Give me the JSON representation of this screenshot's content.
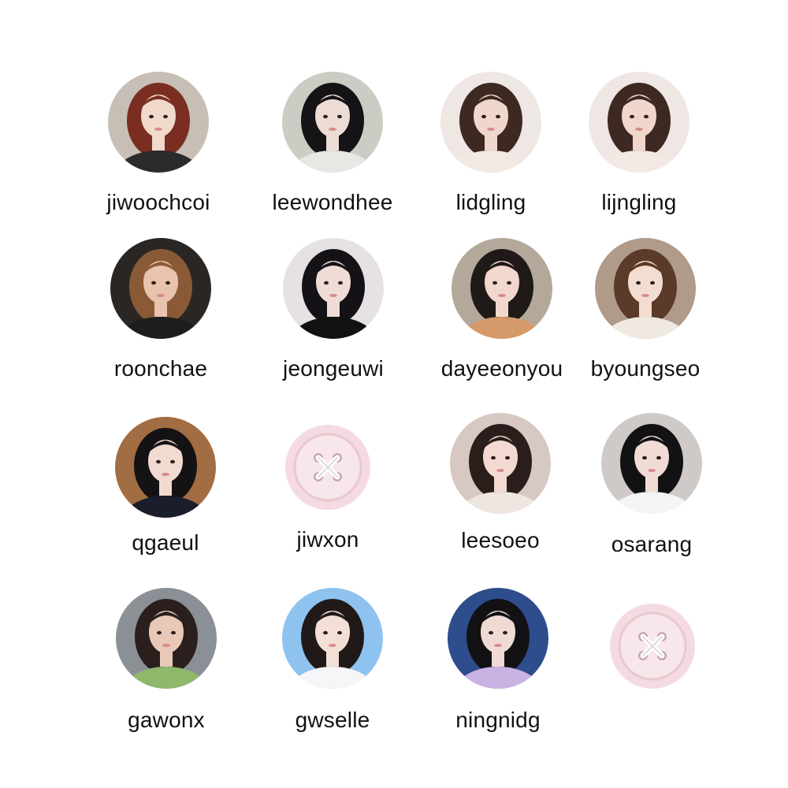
{
  "profiles": [
    {
      "username": "jiwoochcoi",
      "avatar": "photo",
      "bg": "#c7bfb6",
      "hair": "#7a2e22",
      "skin": "#f1d9cc",
      "top": "#2b2b2b"
    },
    {
      "username": "leewondhee",
      "avatar": "photo",
      "bg": "#c9cdc3",
      "hair": "#151316",
      "skin": "#ecdcd4",
      "top": "#e7e7e4"
    },
    {
      "username": "lidgling",
      "avatar": "photo",
      "bg": "#efe7e4",
      "hair": "#3d2822",
      "skin": "#f0d6cb",
      "top": "#f2e8e4"
    },
    {
      "username": "lijngling",
      "avatar": "photo",
      "bg": "#efe7e4",
      "hair": "#3d2822",
      "skin": "#f0d6cb",
      "top": "#f2e8e4"
    },
    {
      "username": "roonchae",
      "avatar": "photo",
      "bg": "#2a2624",
      "hair": "#8a5a36",
      "skin": "#e9c3ad",
      "top": "#1d1d1d"
    },
    {
      "username": "jeongeuwi",
      "avatar": "photo",
      "bg": "#e6e2e3",
      "hair": "#141216",
      "skin": "#efdcd6",
      "top": "#121212"
    },
    {
      "username": "dayeeonyou",
      "avatar": "photo",
      "bg": "#b3a89a",
      "hair": "#1f1a18",
      "skin": "#f2d7cc",
      "top": "#d69a6a"
    },
    {
      "username": "byoungseo",
      "avatar": "photo",
      "bg": "#b09a8a",
      "hair": "#5a3a28",
      "skin": "#f3ddd1",
      "top": "#efe9e1"
    },
    {
      "username": "qgaeul",
      "avatar": "photo",
      "bg": "#a26d43",
      "hair": "#151214",
      "skin": "#f1dbd1",
      "top": "#1a1d2c"
    },
    {
      "username": "jiwxon",
      "avatar": "button",
      "bg": "#f4dbe1",
      "hair": "",
      "skin": "",
      "top": ""
    },
    {
      "username": "leesoeo",
      "avatar": "photo",
      "bg": "#d8c8c3",
      "hair": "#2a1e1c",
      "skin": "#f3d9d1",
      "top": "#efe5e1"
    },
    {
      "username": "osarang",
      "avatar": "photo",
      "bg": "#cfcac8",
      "hair": "#121113",
      "skin": "#f0dcd4",
      "top": "#f5f5f5"
    },
    {
      "username": "gawonx",
      "avatar": "photo",
      "bg": "#8b8f96",
      "hair": "#2a1f1c",
      "skin": "#e8c9b8",
      "top": "#8fb86a"
    },
    {
      "username": "gwselle",
      "avatar": "photo",
      "bg": "#8fc3ef",
      "hair": "#1f1917",
      "skin": "#f3dfd6",
      "top": "#f6f6f8"
    },
    {
      "username": "ningnidg",
      "avatar": "photo",
      "bg": "#2e4d8c",
      "hair": "#121114",
      "skin": "#f0dad4",
      "top": "#c9b3e3"
    },
    {
      "username": "",
      "avatar": "button",
      "bg": "#f4dbe1",
      "hair": "",
      "skin": "",
      "top": ""
    }
  ]
}
